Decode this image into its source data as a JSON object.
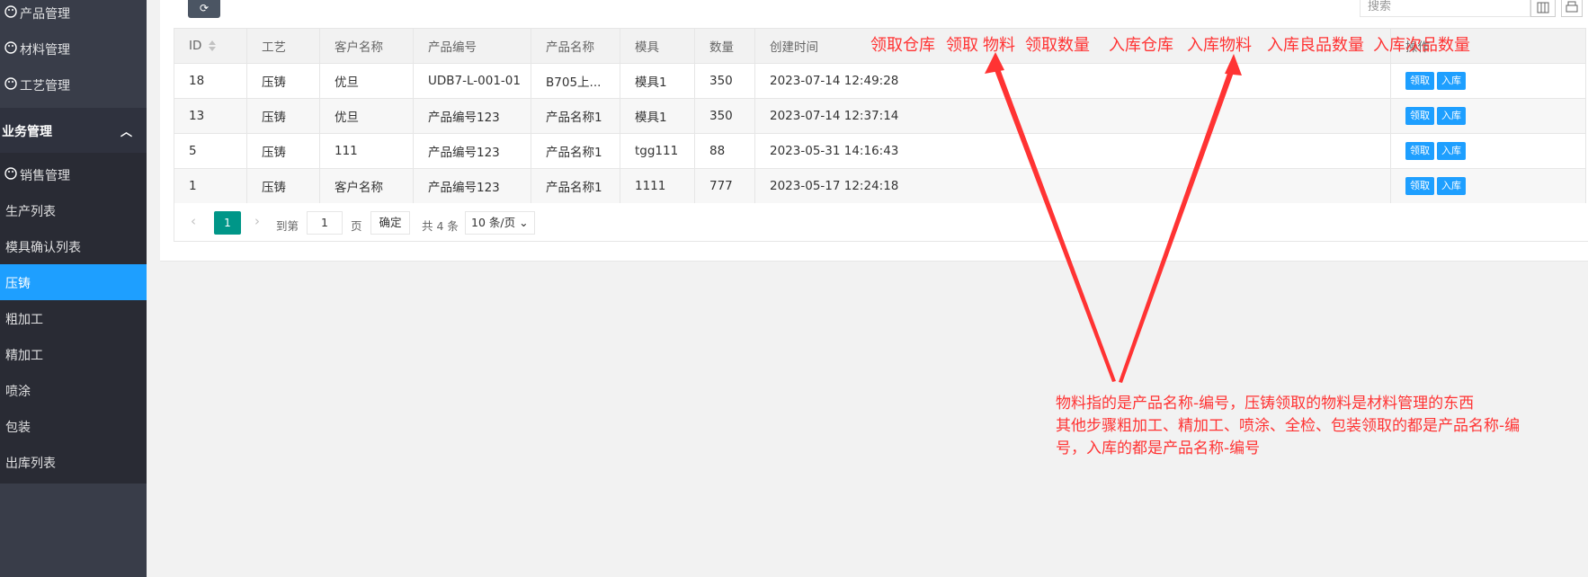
{
  "sidebar": {
    "top_items": [
      "产品管理",
      "材料管理",
      "工艺管理"
    ],
    "group_title": "业务管理",
    "sub_items": [
      "销售管理",
      "生产列表",
      "模具确认列表",
      "压铸",
      "粗加工",
      "精加工",
      "喷涂",
      "包装",
      "出库列表"
    ],
    "active_index": 3
  },
  "toolbar": {
    "refresh_icon": "refresh-icon",
    "search_placeholder": "搜索"
  },
  "table": {
    "headers": [
      "ID",
      "工艺",
      "客户名称",
      "产品编号",
      "产品名称",
      "模具",
      "数量",
      "创建时间",
      "操作"
    ],
    "rows": [
      {
        "id": "18",
        "process": "压铸",
        "customer": "优旦",
        "code": "UDB7-L-001-01",
        "name": "B705上...",
        "mold": "模具1",
        "qty": "350",
        "time": "2023-07-14 12:49:28"
      },
      {
        "id": "13",
        "process": "压铸",
        "customer": "优旦",
        "code": "产品编号123",
        "name": "产品名称1",
        "mold": "模具1",
        "qty": "350",
        "time": "2023-07-14 12:37:14"
      },
      {
        "id": "5",
        "process": "压铸",
        "customer": "111",
        "code": "产品编号123",
        "name": "产品名称1",
        "mold": "tgg111",
        "qty": "88",
        "time": "2023-05-31 14:16:43"
      },
      {
        "id": "1",
        "process": "压铸",
        "customer": "客户名称",
        "code": "产品编号123",
        "name": "产品名称1",
        "mold": "1111",
        "qty": "777",
        "time": "2023-05-17 12:24:18"
      }
    ],
    "actions": {
      "receive": "领取",
      "stock_in": "入库"
    }
  },
  "pager": {
    "current": "1",
    "goto_label": "到第",
    "page_input": "1",
    "page_label": "页",
    "confirm": "确定",
    "total": "共 4 条",
    "per_page": "10 条/页"
  },
  "annotations": {
    "columns": [
      "领取仓库",
      "领取",
      "物料",
      "领取数量",
      "入库仓库",
      "入库物料",
      "入库良品数量",
      "入库次品数量"
    ],
    "note_lines": [
      "物料指的是产品名称-编号，压铸领取的物料是材料管理的东西",
      "其他步骤粗加工、精加工、喷涂、全检、包装领取的都是产品名称-编",
      "号，入库的都是产品名称-编号"
    ],
    "color": "#ff3333"
  }
}
